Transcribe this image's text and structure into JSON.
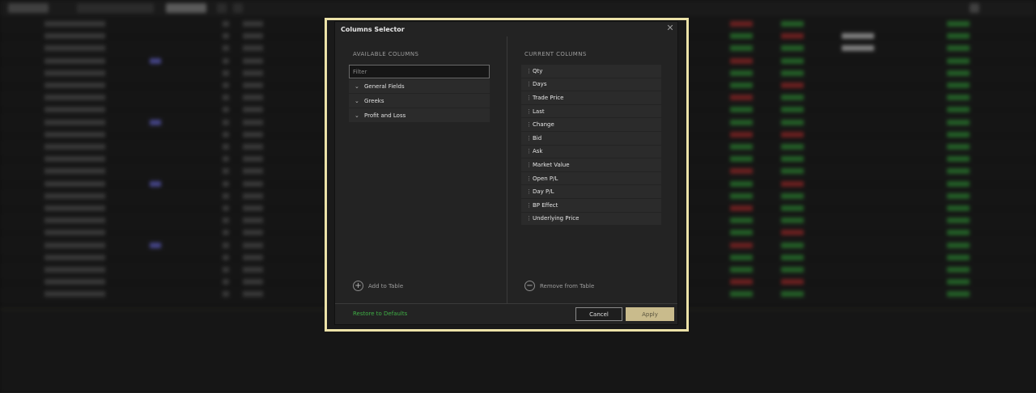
{
  "modal": {
    "title": "Columns Selector",
    "close_glyph": "✕",
    "available": {
      "label": "AVAILABLE COLUMNS",
      "filter_placeholder": "Filter",
      "groups": [
        {
          "label": "General Fields"
        },
        {
          "label": "Greeks"
        },
        {
          "label": "Profit and Loss"
        }
      ],
      "add_label": "Add to Table"
    },
    "current": {
      "label": "CURRENT COLUMNS",
      "columns": [
        {
          "label": "Qty"
        },
        {
          "label": "Days"
        },
        {
          "label": "Trade Price"
        },
        {
          "label": "Last"
        },
        {
          "label": "Change"
        },
        {
          "label": "Bid"
        },
        {
          "label": "Ask"
        },
        {
          "label": "Market Value"
        },
        {
          "label": "Open P/L"
        },
        {
          "label": "Day P/L"
        },
        {
          "label": "BP Effect"
        },
        {
          "label": "Underlying Price"
        }
      ],
      "remove_label": "Remove from Table"
    },
    "footer": {
      "restore_label": "Restore to Defaults",
      "cancel_label": "Cancel",
      "apply_label": "Apply"
    }
  },
  "icons": {
    "chevron": "chevron-down-icon",
    "grip": "drag-handle-icon",
    "add": "plus-circle-icon",
    "remove": "minus-circle-icon",
    "close": "close-icon"
  },
  "colors": {
    "accent_border": "#ece2a8",
    "apply_button": "#c9bb8c",
    "restore_link": "#3fae45",
    "background": "#232323"
  }
}
